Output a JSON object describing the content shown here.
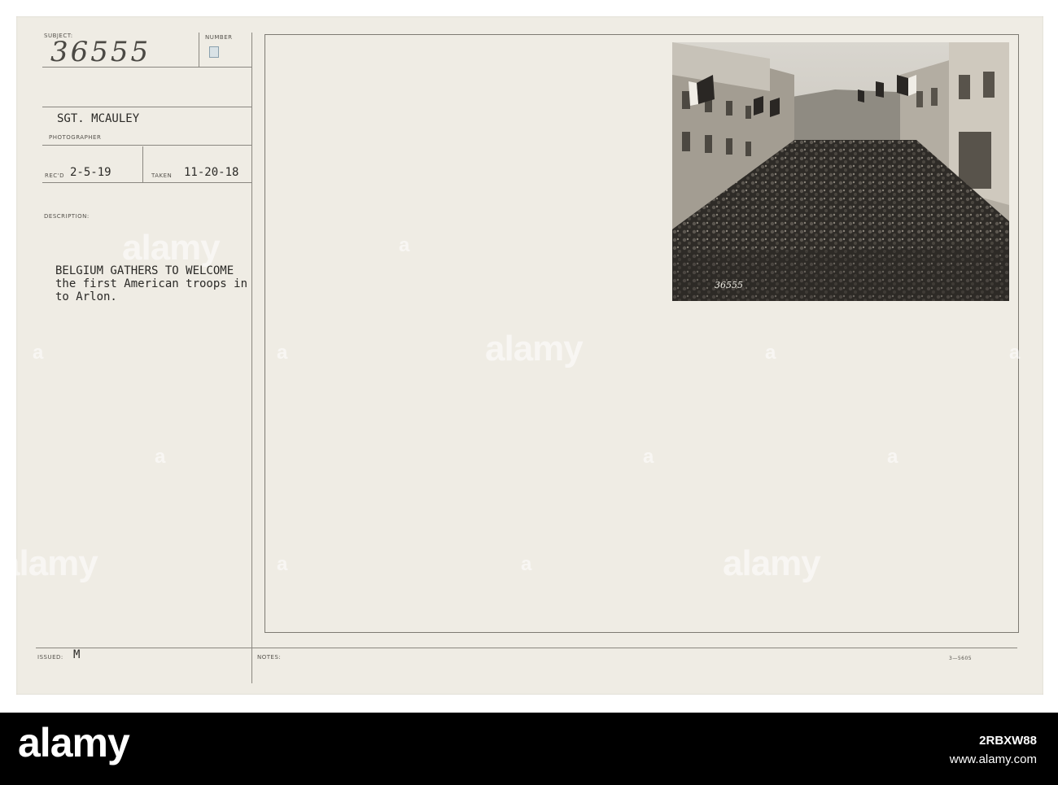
{
  "record": {
    "subject_label": "SUBJECT:",
    "number_label": "NUMBER",
    "subject_number": "36555",
    "photographer_name": "SGT. MCAULEY",
    "photographer_label": "PHOTOGRAPHER",
    "recd_label": "REC'D",
    "recd_date": "2-5-19",
    "taken_label": "TAKEN",
    "taken_date": "11-20-18",
    "description_label": "DESCRIPTION:",
    "description_lines": [
      "BELGIUM GATHERS TO WELCOME",
      "the first American troops in",
      "to Arlon."
    ],
    "issued_label": "ISSUED:",
    "issued_value": "M",
    "notes_label": "NOTES:",
    "form_code": "3—5605"
  },
  "photo": {
    "number_on_print": "36555",
    "subject": "crowd-street-with-flags"
  },
  "watermark": {
    "text": "alamy",
    "mark": "a"
  },
  "footer": {
    "logo": "alamy",
    "image_id": "2RBXW88",
    "url": "www.alamy.com"
  },
  "colors": {
    "card": "#efece4",
    "ink": "#2a2926",
    "footer": "#000000"
  }
}
